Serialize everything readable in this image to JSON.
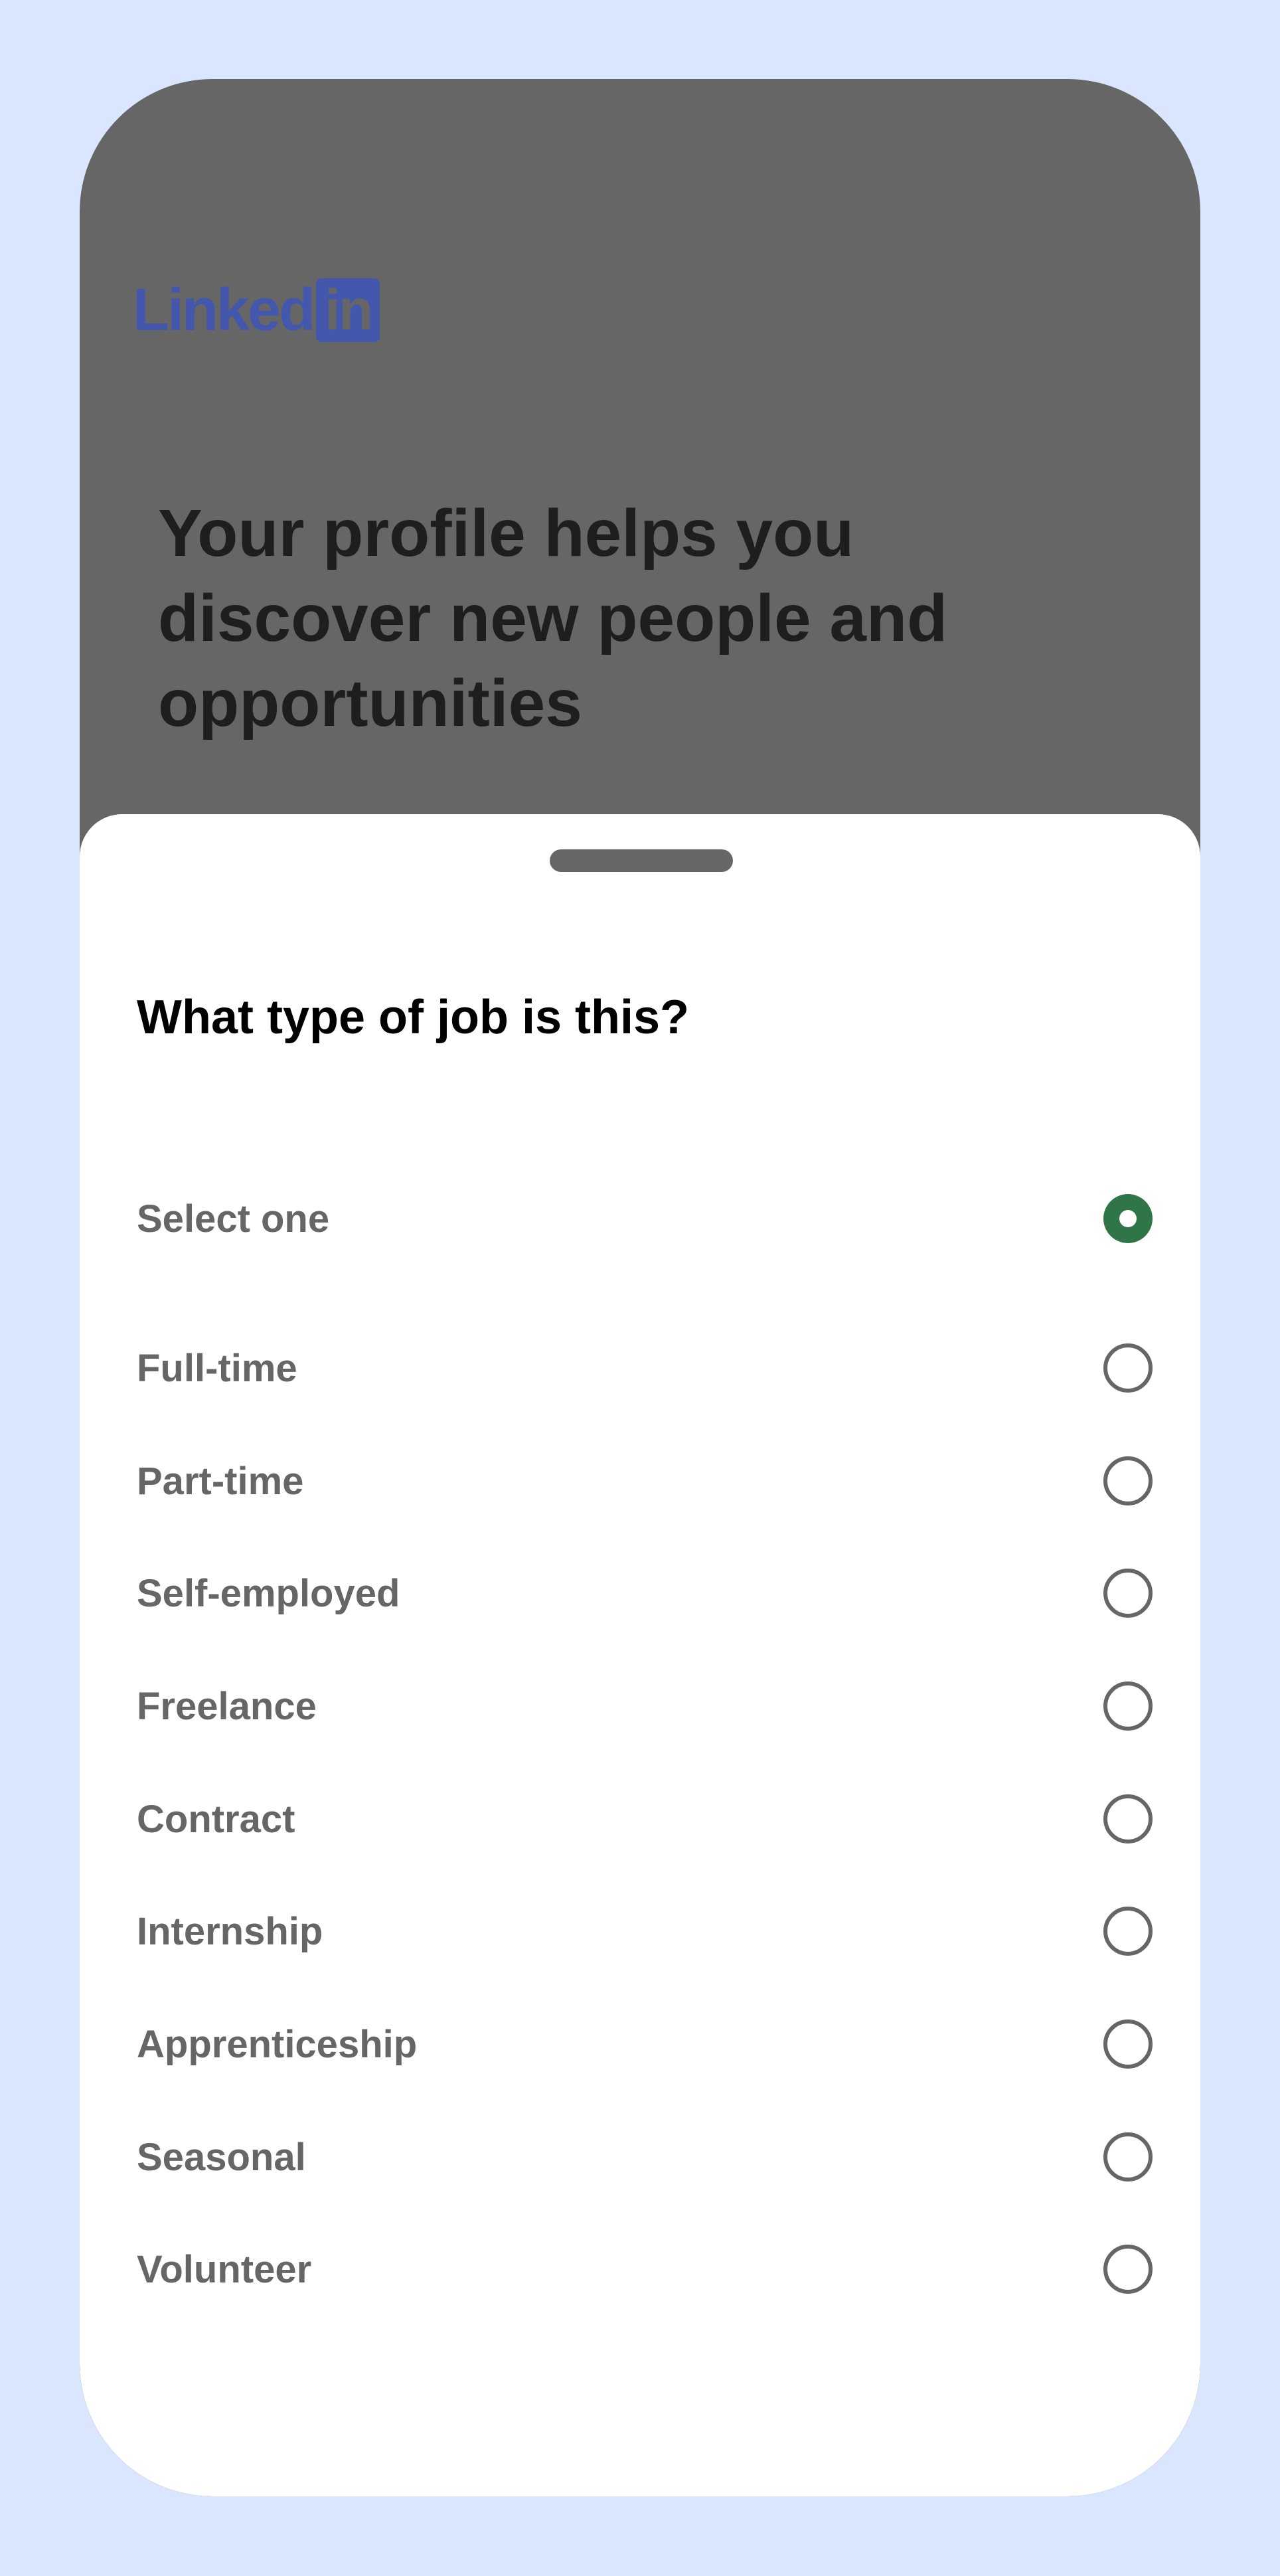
{
  "header": {
    "logo_text": "Linked",
    "logo_box_text": "in",
    "headline": "Your profile helps you discover new people and opportunities"
  },
  "sheet": {
    "title": "What type of job is this?",
    "options": [
      {
        "label": "Select one",
        "selected": true
      },
      {
        "label": "Full-time",
        "selected": false
      },
      {
        "label": "Part-time",
        "selected": false
      },
      {
        "label": "Self-employed",
        "selected": false
      },
      {
        "label": "Freelance",
        "selected": false
      },
      {
        "label": "Contract",
        "selected": false
      },
      {
        "label": "Internship",
        "selected": false
      },
      {
        "label": "Apprenticeship",
        "selected": false
      },
      {
        "label": "Seasonal",
        "selected": false
      },
      {
        "label": "Volunteer",
        "selected": false
      }
    ]
  },
  "colors": {
    "background": "#d9e6fd",
    "overlay": "#666666",
    "brand": "#4358ad",
    "selected_radio": "#2f7547",
    "option_text": "#666666"
  },
  "icons": [
    "linkedin-logo",
    "radio-selected-icon",
    "radio-unselected-icon"
  ]
}
